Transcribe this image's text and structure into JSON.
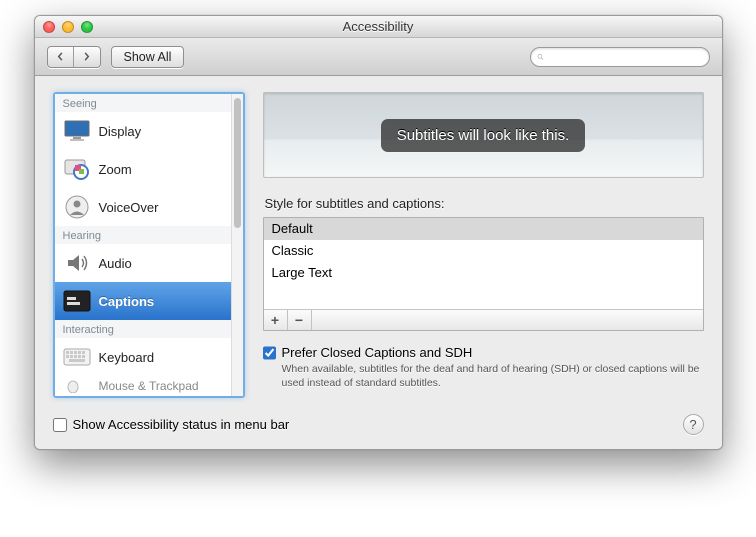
{
  "window": {
    "title": "Accessibility"
  },
  "toolbar": {
    "show_all": "Show All",
    "search_placeholder": ""
  },
  "sidebar": {
    "groups": [
      {
        "label": "Seeing",
        "items": [
          {
            "label": "Display",
            "icon": "display"
          },
          {
            "label": "Zoom",
            "icon": "zoom"
          },
          {
            "label": "VoiceOver",
            "icon": "voiceover"
          }
        ]
      },
      {
        "label": "Hearing",
        "items": [
          {
            "label": "Audio",
            "icon": "audio"
          },
          {
            "label": "Captions",
            "icon": "captions",
            "active": true
          }
        ]
      },
      {
        "label": "Interacting",
        "items": [
          {
            "label": "Keyboard",
            "icon": "keyboard"
          },
          {
            "label": "Mouse & Trackpad",
            "icon": "mouse",
            "cut": true
          }
        ]
      }
    ]
  },
  "main": {
    "preview_text": "Subtitles will look like this.",
    "style_label": "Style for subtitles and captions:",
    "styles": [
      "Default",
      "Classic",
      "Large Text"
    ],
    "selected_style_index": 0,
    "prefer_checkbox_label": "Prefer Closed Captions and SDH",
    "prefer_checkbox_sub": "When available, subtitles for the deaf and hard of hearing (SDH) or closed captions will be used instead of standard subtitles.",
    "prefer_checked": true
  },
  "footer": {
    "status_label": "Show Accessibility status in menu bar",
    "status_checked": false
  }
}
